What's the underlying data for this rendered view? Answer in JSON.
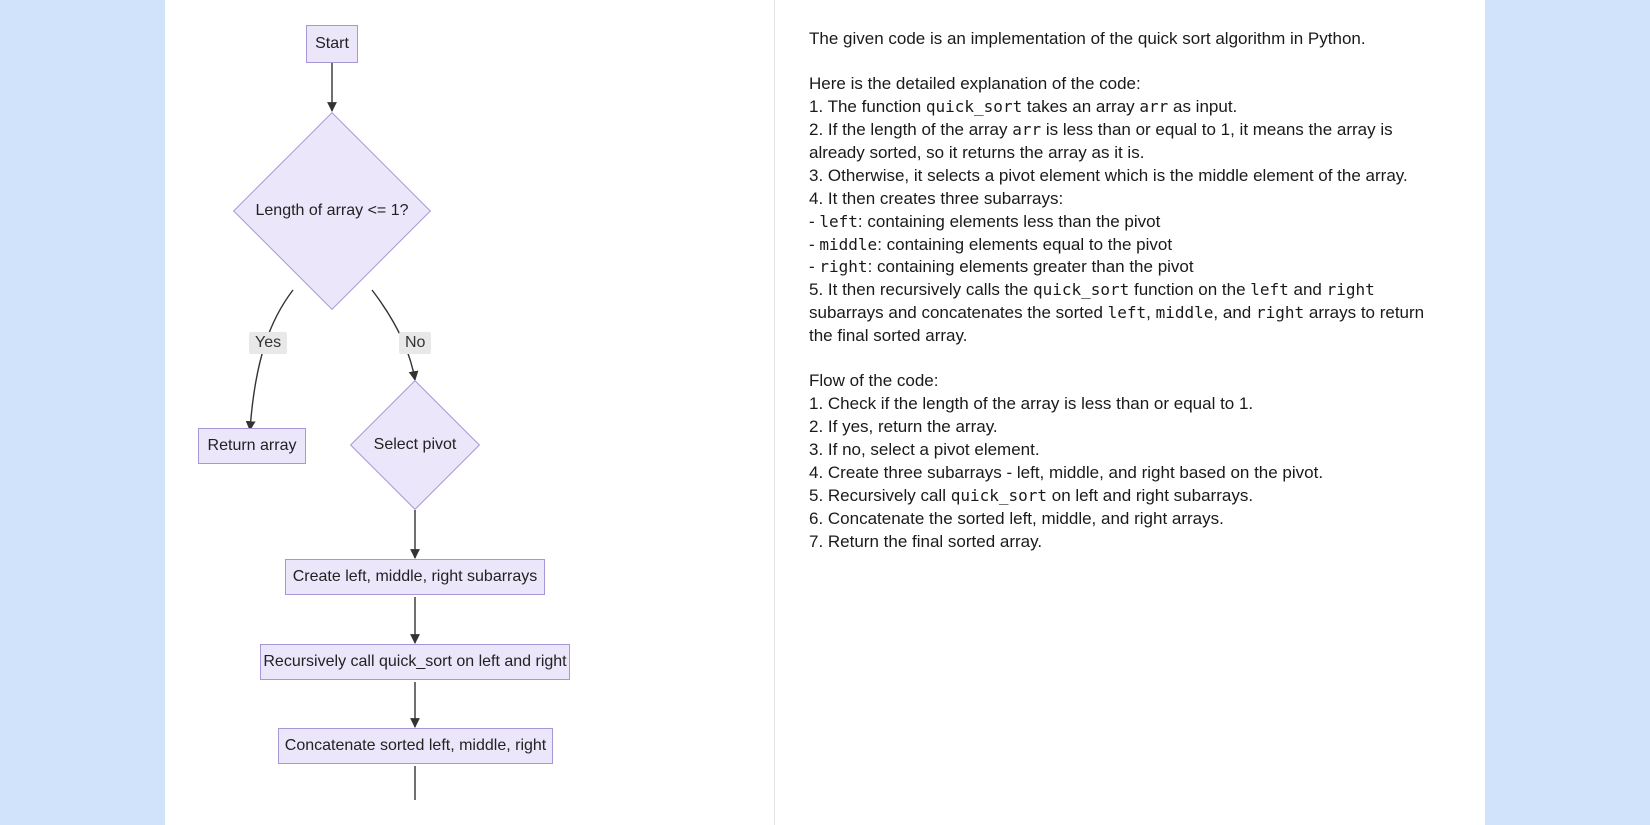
{
  "flowchart": {
    "nodes": {
      "start": "Start",
      "check": "Length of array <= 1?",
      "yes_label": "Yes",
      "no_label": "No",
      "return_array": "Return array",
      "select_pivot": "Select pivot",
      "create_sub": "Create left, middle, right subarrays",
      "recurse": "Recursively call quick_sort on left and right",
      "concat": "Concatenate sorted left, middle, right"
    }
  },
  "explanation": {
    "intro": "The given code is an implementation of the quick sort algorithm in Python.",
    "detail_header": "Here is the detailed explanation of the code:",
    "d1": "1. The function `quick_sort` takes an array `arr` as input.",
    "d2": "2. If the length of the array `arr` is less than or equal to 1, it means the array is already sorted, so it returns the array as it is.",
    "d3": "3. Otherwise, it selects a pivot element which is the middle element of the array.",
    "d4": "4. It then creates three subarrays:",
    "d4a": "- `left`: containing elements less than the pivot",
    "d4b": "- `middle`: containing elements equal to the pivot",
    "d4c": "- `right`: containing elements greater than the pivot",
    "d5": "5. It then recursively calls the `quick_sort` function on the `left` and `right` subarrays and concatenates the sorted `left`, `middle`, and `right` arrays to return the final sorted array.",
    "flow_header": "Flow of the code:",
    "f1": "1. Check if the length of the array is less than or equal to 1.",
    "f2": "2. If yes, return the array.",
    "f3": "3. If no, select a pivot element.",
    "f4": "4. Create three subarrays - left, middle, and right based on the pivot.",
    "f5": "5. Recursively call `quick_sort` on left and right subarrays.",
    "f6": "6. Concatenate the sorted left, middle, and right arrays.",
    "f7": "7. Return the final sorted array."
  },
  "chart_data": {
    "type": "flowchart",
    "nodes": [
      {
        "id": "start",
        "shape": "rect",
        "label": "Start"
      },
      {
        "id": "check",
        "shape": "diamond",
        "label": "Length of array <= 1?"
      },
      {
        "id": "return_array",
        "shape": "rect",
        "label": "Return array"
      },
      {
        "id": "select_pivot",
        "shape": "diamond",
        "label": "Select pivot"
      },
      {
        "id": "create_sub",
        "shape": "rect",
        "label": "Create left, middle, right subarrays"
      },
      {
        "id": "recurse",
        "shape": "rect",
        "label": "Recursively call quick_sort on left and right"
      },
      {
        "id": "concat",
        "shape": "rect",
        "label": "Concatenate sorted left, middle, right"
      }
    ],
    "edges": [
      {
        "from": "start",
        "to": "check",
        "label": ""
      },
      {
        "from": "check",
        "to": "return_array",
        "label": "Yes"
      },
      {
        "from": "check",
        "to": "select_pivot",
        "label": "No"
      },
      {
        "from": "select_pivot",
        "to": "create_sub",
        "label": ""
      },
      {
        "from": "create_sub",
        "to": "recurse",
        "label": ""
      },
      {
        "from": "recurse",
        "to": "concat",
        "label": ""
      }
    ]
  }
}
